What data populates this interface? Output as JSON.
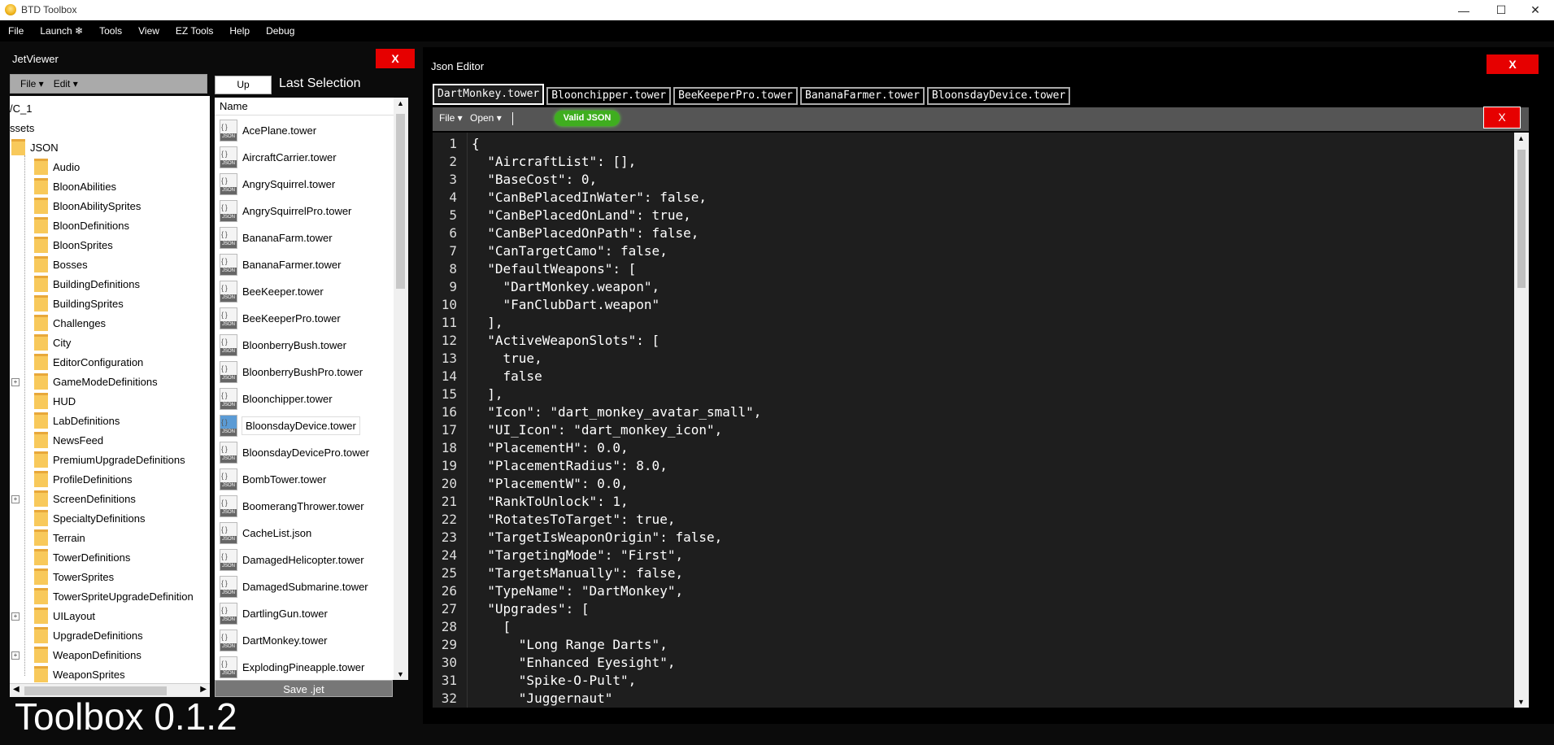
{
  "window": {
    "title": "BTD Toolbox",
    "icon": "monkey-money-icon"
  },
  "menubar": [
    "File",
    "Launch ❄",
    "Tools",
    "View",
    "EZ Tools",
    "Help",
    "Debug"
  ],
  "jetviewer": {
    "title": "JetViewer",
    "close_label": "X",
    "file_menu": "File ▾",
    "edit_menu": "Edit ▾",
    "tree_root": [
      "/C_1",
      "ssets",
      "JSON"
    ],
    "tree_children": [
      "Audio",
      "BloonAbilities",
      "BloonAbilitySprites",
      "BloonDefinitions",
      "BloonSprites",
      "Bosses",
      "BuildingDefinitions",
      "BuildingSprites",
      "Challenges",
      "City",
      "EditorConfiguration",
      "GameModeDefinitions",
      "HUD",
      "LabDefinitions",
      "NewsFeed",
      "PremiumUpgradeDefinitions",
      "ProfileDefinitions",
      "ScreenDefinitions",
      "SpecialtyDefinitions",
      "Terrain",
      "TowerDefinitions",
      "TowerSprites",
      "TowerSpriteUpgradeDefinition",
      "UILayout",
      "UpgradeDefinitions",
      "WeaponDefinitions",
      "WeaponSprites"
    ],
    "expandable": [
      "GameModeDefinitions",
      "ScreenDefinitions",
      "UILayout",
      "WeaponDefinitions"
    ],
    "up_label": "Up",
    "last_selection_label": "Last Selection",
    "list_header": "Name",
    "files": [
      "AcePlane.tower",
      "AircraftCarrier.tower",
      "AngrySquirrel.tower",
      "AngrySquirrelPro.tower",
      "BananaFarm.tower",
      "BananaFarmer.tower",
      "BeeKeeper.tower",
      "BeeKeeperPro.tower",
      "BloonberryBush.tower",
      "BloonberryBushPro.tower",
      "Bloonchipper.tower",
      "BloonsdayDevice.tower",
      "BloonsdayDevicePro.tower",
      "BombTower.tower",
      "BoomerangThrower.tower",
      "CacheList.json",
      "DamagedHelicopter.tower",
      "DamagedSubmarine.tower",
      "DartlingGun.tower",
      "DartMonkey.tower",
      "ExplodingPineapple.tower"
    ],
    "selected_file": "BloonsdayDevice.tower",
    "save_label": "Save .jet"
  },
  "version": "Toolbox 0.1.2",
  "json_editor": {
    "title": "Json Editor",
    "close_label": "X",
    "tabs": [
      "DartMonkey.tower",
      "Bloonchipper.tower",
      "BeeKeeperPro.tower",
      "BananaFarmer.tower",
      "BloonsdayDevice.tower"
    ],
    "active_tab": 0,
    "file_menu": "File ▾",
    "open_menu": "Open ▾",
    "valid_badge": "Valid JSON",
    "inner_close": "X",
    "code_lines": [
      "{",
      "  \"AircraftList\": [],",
      "  \"BaseCost\": 0,",
      "  \"CanBePlacedInWater\": false,",
      "  \"CanBePlacedOnLand\": true,",
      "  \"CanBePlacedOnPath\": false,",
      "  \"CanTargetCamo\": false,",
      "  \"DefaultWeapons\": [",
      "    \"DartMonkey.weapon\",",
      "    \"FanClubDart.weapon\"",
      "  ],",
      "  \"ActiveWeaponSlots\": [",
      "    true,",
      "    false",
      "  ],",
      "  \"Icon\": \"dart_monkey_avatar_small\",",
      "  \"UI_Icon\": \"dart_monkey_icon\",",
      "  \"PlacementH\": 0.0,",
      "  \"PlacementRadius\": 8.0,",
      "  \"PlacementW\": 0.0,",
      "  \"RankToUnlock\": 1,",
      "  \"RotatesToTarget\": true,",
      "  \"TargetIsWeaponOrigin\": false,",
      "  \"TargetingMode\": \"First\",",
      "  \"TargetsManually\": false,",
      "  \"TypeName\": \"DartMonkey\",",
      "  \"Upgrades\": [",
      "    [",
      "      \"Long Range Darts\",",
      "      \"Enhanced Eyesight\",",
      "      \"Spike-O-Pult\",",
      "      \"Juggernaut\""
    ]
  },
  "colors": {
    "close_red": "#e60000",
    "valid_green": "#3fae1f",
    "editor_bg": "#1e1e1e"
  }
}
